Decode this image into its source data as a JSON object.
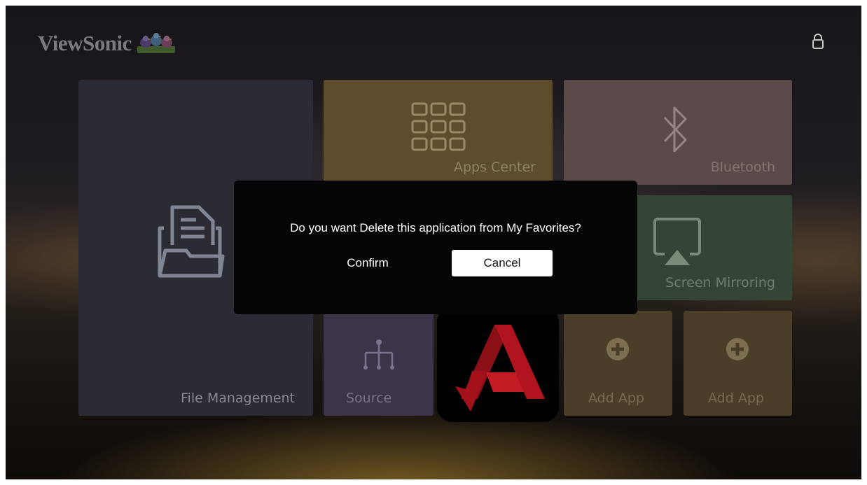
{
  "brand": {
    "name": "ViewSonic"
  },
  "tiles": {
    "file_management": "File Management",
    "apps_center": "Apps Center",
    "bluetooth": "Bluetooth",
    "screen_mirroring": "Screen Mirroring",
    "source": "Source",
    "add_app_1": "Add App",
    "add_app_2": "Add App"
  },
  "dialog": {
    "message": "Do you want Delete this application from My Favorites?",
    "confirm_label": "Confirm",
    "cancel_label": "Cancel"
  },
  "icons": {
    "lock": "lock-icon",
    "folder": "folder-icon",
    "apps": "grid-icon",
    "bluetooth": "bluetooth-icon",
    "mirroring": "screen-mirroring-icon",
    "source": "source-icon",
    "add": "plus-circle-icon",
    "app": "acrobat-reader-icon"
  },
  "colors": {
    "dialog_bg": "#050505",
    "cancel_bg": "#ffffff",
    "apps_tile": "#5d4d2d",
    "bluetooth_tile": "#5c4a4b",
    "mirroring_tile": "#344435",
    "source_tile": "#3d3449",
    "add_app_tile": "#4a3e28",
    "acrobat_red": "#b0141e"
  }
}
